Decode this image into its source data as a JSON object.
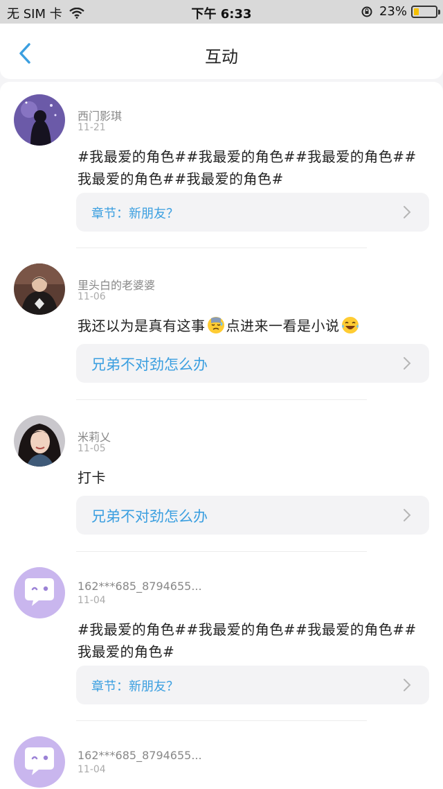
{
  "status_bar": {
    "carrier": "无 SIM 卡",
    "time": "下午 6:33",
    "battery_text": "23%",
    "battery_level": 0.23
  },
  "header": {
    "title": "互动"
  },
  "posts": [
    {
      "user": "西门影琪",
      "date": "11-21",
      "text": "#我最爱的角色##我最爱的角色##我最爱的角色##我最爱的角色##我最爱的角色#",
      "link": "章节：新朋友？"
    },
    {
      "user": "里头白的老婆婆",
      "date": "11-06",
      "text_before": "我还以为是真有这事",
      "text_middle": "点进来一看是小说",
      "link": "兄弟不对劲怎么办"
    },
    {
      "user": "米莉乂",
      "date": "11-05",
      "text": "打卡",
      "link": "兄弟不对劲怎么办"
    },
    {
      "user": "162***685_8794655...",
      "date": "11-04",
      "text": "#我最爱的角色##我最爱的角色##我最爱的角色##我最爱的角色#",
      "link": "章节：新朋友？"
    },
    {
      "user": "162***685_8794655...",
      "date": "11-04"
    }
  ],
  "colors": {
    "accent": "#3b9fe0",
    "default_avatar": "#c9b6ee"
  }
}
